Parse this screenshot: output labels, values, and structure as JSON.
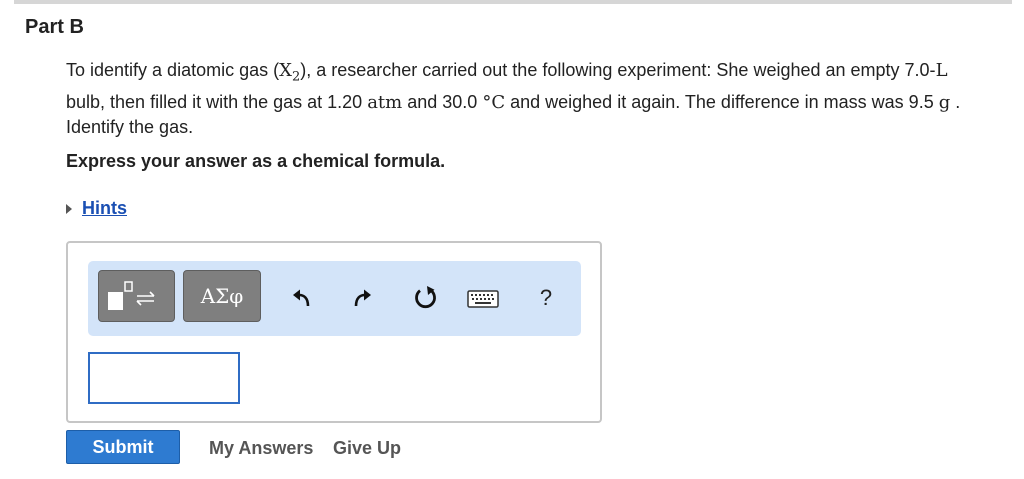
{
  "part": {
    "title": "Part B"
  },
  "question": {
    "t1": "To identify a diatomic gas (",
    "m1": "X",
    "sub": "2",
    "t2": "), a researcher carried out the following experiment: She weighed an empty 7.0-",
    "m2": "L",
    "t3": " bulb, then filled it with the gas at 1.20 ",
    "m3": "atm",
    "t4": " and 30.0 ",
    "m4": "°C",
    "t5": " and weighed it again. The difference in mass was 9.5 ",
    "m5": "g",
    "t6": " . Identify the gas."
  },
  "instruction": "Express your answer as a chemical formula.",
  "hints": {
    "label": "Hints"
  },
  "toolbar": {
    "greek_label": "ΑΣφ",
    "help_label": "?",
    "icons": [
      "templates-icon",
      "undo-icon",
      "redo-icon",
      "reset-icon",
      "keyboard-icon",
      "help-icon"
    ]
  },
  "answer": {
    "value": ""
  },
  "actions": {
    "submit_label": "Submit",
    "my_answers_label": "My Answers",
    "give_up_label": "Give Up"
  },
  "colors": {
    "toolbar_bg": "#d3e4f9",
    "submit_bg": "#2e7bd1",
    "link_blue": "#1a4fb3",
    "input_border": "#2f6cc4"
  }
}
